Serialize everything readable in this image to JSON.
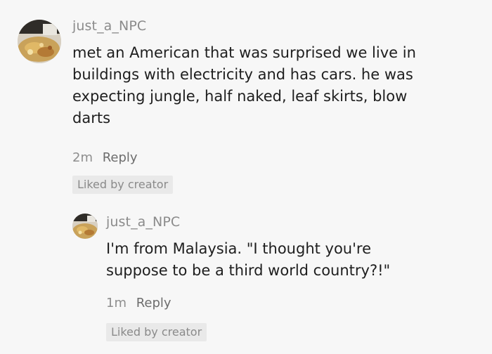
{
  "comments": [
    {
      "username": "just_a_NPC",
      "text_lines": [
        "met an American that was surprised we live in",
        "buildings with electricity and has cars. he was",
        "expecting jungle, half naked, leaf skirts, blow",
        "darts"
      ],
      "time": "2m",
      "reply_label": "Reply",
      "badge": "Liked by creator"
    },
    {
      "username": "just_a_NPC",
      "text_lines": [
        "I'm from Malaysia. \"I thought you're",
        "suppose to be a third world country?!\""
      ],
      "time": "1m",
      "reply_label": "Reply",
      "badge": "Liked by creator"
    }
  ],
  "colors": {
    "background": "#f7f7f7",
    "text": "#1e1e1e",
    "muted": "#8b8b8b",
    "badge_bg": "#e9e9e9"
  }
}
